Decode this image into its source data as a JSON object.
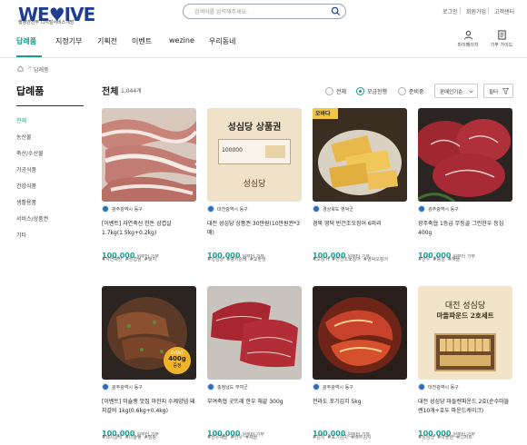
{
  "header": {
    "logo_text": "WE♥IVE",
    "logo_sub": "행정안전부 디지털서비스개방",
    "search_placeholder": "검색어를 입력해주세요.",
    "util_links": [
      "로그인",
      "회원가입",
      "고객센터"
    ],
    "nav": [
      "답례품",
      "지정기부",
      "기획전",
      "이벤트",
      "wezine",
      "우리동네"
    ],
    "icons": [
      {
        "label": "마이페이지",
        "icon": "person-icon"
      },
      {
        "label": "기부 가이드",
        "icon": "guide-icon"
      }
    ]
  },
  "breadcrumb": {
    "home": "home-icon",
    "sep": ">",
    "current": "답례품"
  },
  "sidebar": {
    "title": "답례품",
    "items": [
      "전체",
      "농산물",
      "축산/수산물",
      "가공식품",
      "건강식품",
      "생활용품",
      "서비스/상품권",
      "기타"
    ]
  },
  "list": {
    "title": "전체",
    "count": "1,044개",
    "radios": [
      "전체",
      "모금진행",
      "준비중"
    ],
    "sort": "판매인기순",
    "filter": "필터"
  },
  "products": [
    {
      "seller": "광주광역시 동구",
      "title": "[이벤트] 자연축산 한돈 삼겹살 1.7kg(1.5kg+0.2kg)",
      "price": "100,000",
      "price_sub": "원부터 기부",
      "tags": [
        "#자연축산",
        "#삼겹살",
        "#돼지"
      ]
    },
    {
      "seller": "대전광역시 동구",
      "title": "대전 성심당 상품권 30만원(10만원권*3매)",
      "price": "100,000",
      "price_sub": "원부터 기부",
      "tags": [
        "#성심당",
        "#빵지순례",
        "#교환권"
      ]
    },
    {
      "seller": "경상북도 영덕군",
      "title": "경북 영덕 반건조오징어 6마리",
      "price": "100,000",
      "price_sub": "원부터 기부",
      "tags": [
        "#오징어",
        "#반건조오징어",
        "#영덕오징어"
      ]
    },
    {
      "seller": "광주광역시 동구",
      "title": "광주축협 1등급 무등골 그린한우 등심 400g",
      "price": "100,000",
      "price_sub": "원부터 기부",
      "tags": [
        "#한우",
        "#등심",
        "#해뜰"
      ]
    },
    {
      "seller": "광주광역시 동구",
      "title": "[이벤트] 미슐랭 맛집 마한지 수제양념 돼지갈비 1kg(0.6kg+0.4kg)",
      "price": "100,000",
      "price_sub": "원부터 기부",
      "tags": [
        "#돼지갈비",
        "#미슐랭",
        "#캠핑"
      ],
      "badge": [
        "EVENT",
        "400g",
        "증정"
      ]
    },
    {
      "seller": "충청남도 부여군",
      "title": "부여축협 굿뜨래 한우 채끝 300g",
      "price": "100,000",
      "price_sub": "원부터 기부",
      "tags": [
        "#한우채끝",
        "#한우",
        "#채끝"
      ]
    },
    {
      "seller": "광주광역시 동구",
      "title": "전라도 포기김치 5kg",
      "price": "100,000",
      "price_sub": "원부터 기부",
      "tags": [
        "#김치",
        "#포기김치",
        "#배추김치"
      ]
    },
    {
      "seller": "대전광역시 동구",
      "title": "대전 성심당 마들렌파운드 2호(순수마들렌10개+호두 파운드케이크)",
      "price": "100,000",
      "price_sub": "원부터 기부",
      "tags": [
        "#성심당",
        "#마들렌",
        "#디저트"
      ]
    }
  ],
  "thumb_text": {
    "voucher_title": "성심당 상품권",
    "voucher_amount": "100000",
    "voucher_brand": "성심당",
    "madeleine_line1": "대전 성심당",
    "madeleine_line2": "마들파운드 2호세트",
    "squid_brand": "오바다"
  },
  "colors": {
    "accent": "#1a9e8f",
    "brand": "#1e3f8f"
  }
}
